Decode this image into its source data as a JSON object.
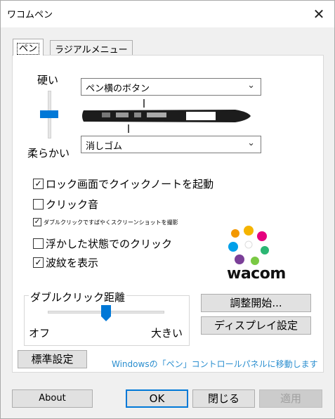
{
  "window": {
    "title": "ワコムペン",
    "close_glyph": "✕"
  },
  "tabs": [
    {
      "label": "ペン",
      "active": true
    },
    {
      "label": "ラジアルメニュー",
      "active": false
    }
  ],
  "pressure": {
    "hard_label": "硬い",
    "soft_label": "柔らかい",
    "level_fraction": 0.42
  },
  "upper_button": {
    "value": "ペン横のボタン"
  },
  "eraser": {
    "value": "消しゴム"
  },
  "options": [
    {
      "label": "ロック画面でクイックノートを起動",
      "checked": true
    },
    {
      "label": "クリック音",
      "checked": false
    },
    {
      "label": "ダブルクリックですばやくスクリーンショットを撮影",
      "checked": true
    },
    {
      "label": "浮かした状態でのクリック",
      "checked": false
    },
    {
      "label": "波紋を表示",
      "checked": true
    }
  ],
  "double_click": {
    "title": "ダブルクリック距離",
    "min_label": "オフ",
    "max_label": "大きい",
    "level_fraction": 0.5
  },
  "buttons": {
    "calibrate": "調整開始...",
    "display": "ディスプレイ設定",
    "defaults": "標準設定",
    "about": "About",
    "ok": "OK",
    "close": "閉じる",
    "apply": "適用"
  },
  "link_text": "Windowsの「ペン」コントロールパネルに移動します",
  "brand": {
    "logo_text": "wacom",
    "icon": "wacom-logo-icon"
  },
  "colors": {
    "accent": "#0078d7",
    "link": "#2a8ecf"
  }
}
